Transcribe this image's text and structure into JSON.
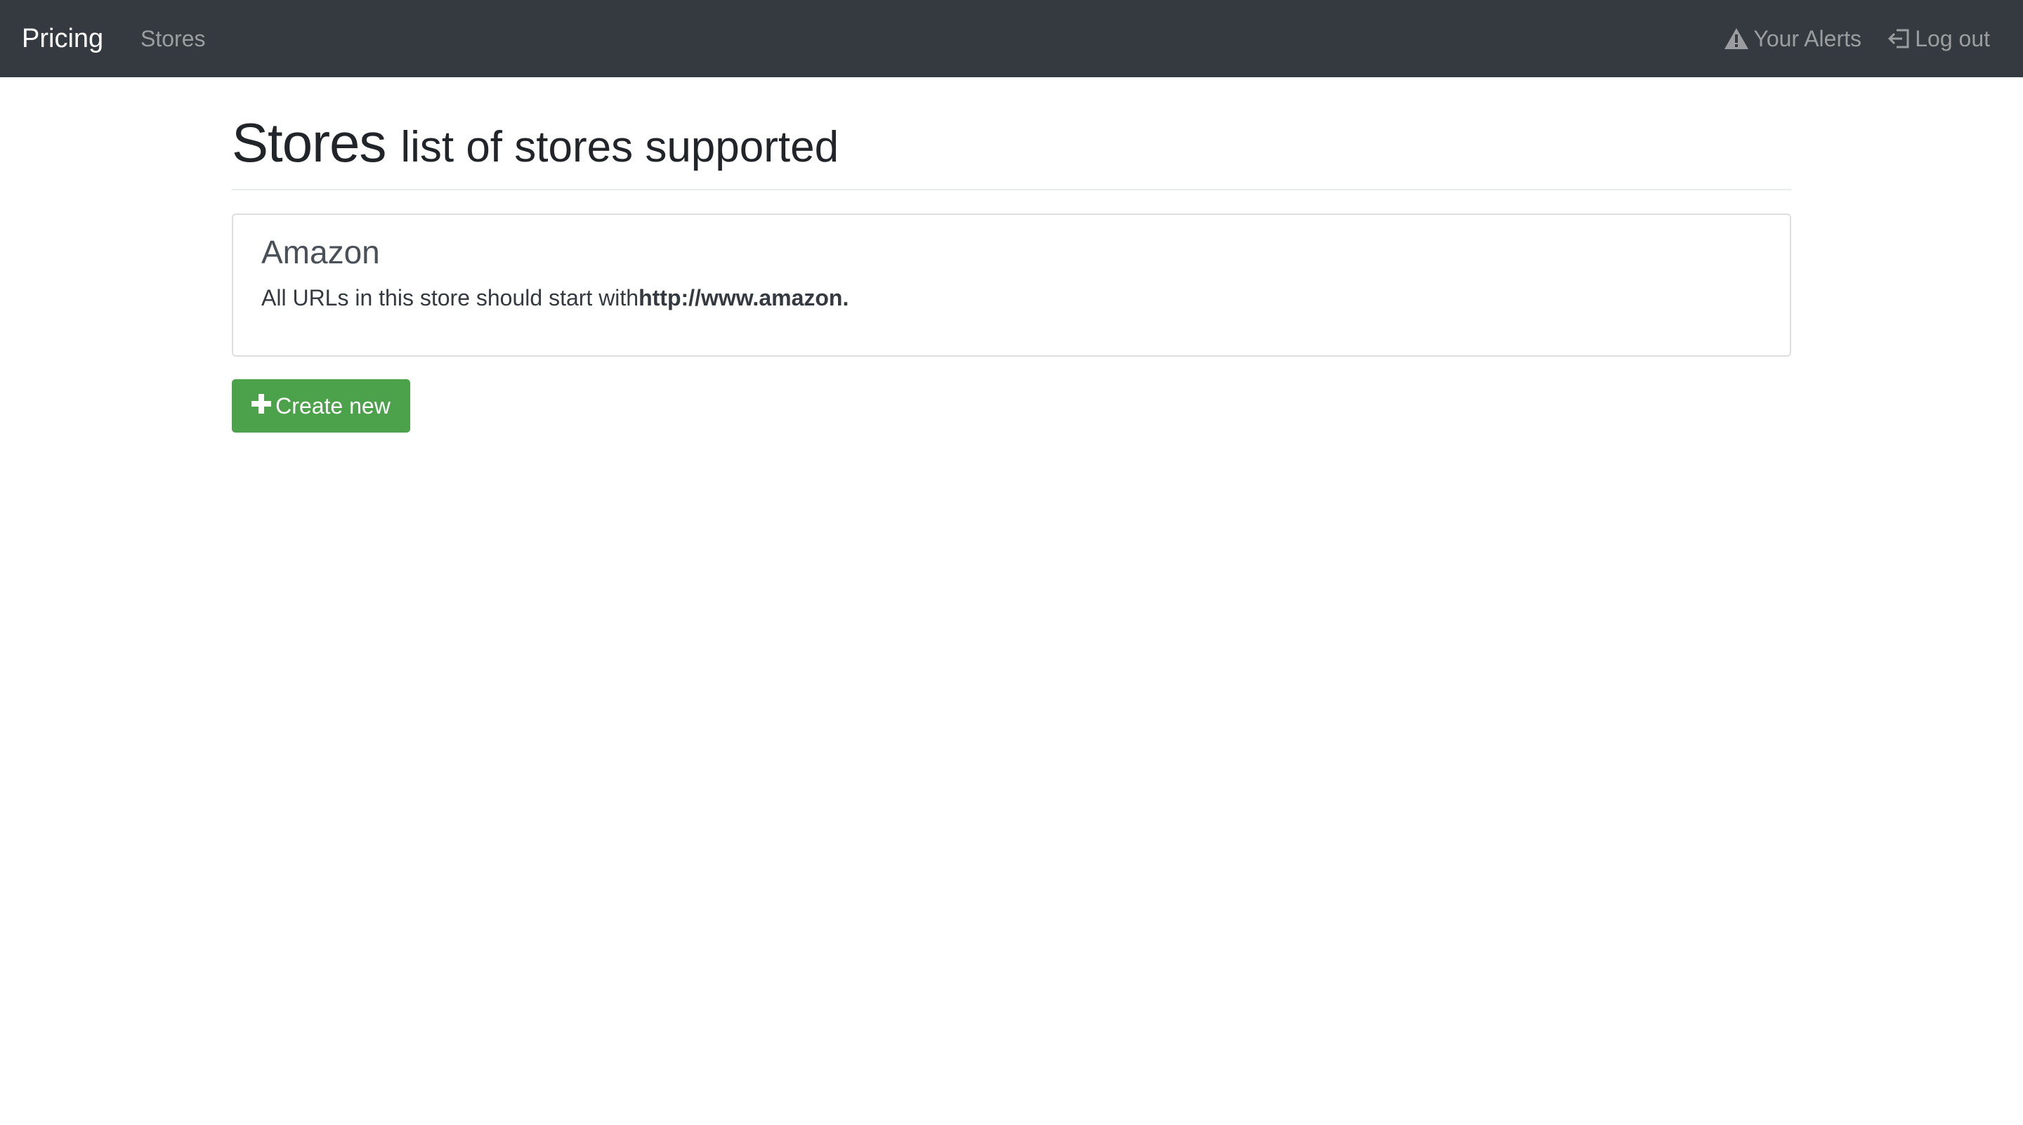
{
  "navbar": {
    "brand": "Pricing",
    "links": {
      "stores": "Stores",
      "alerts": "Your Alerts",
      "logout": "Log out"
    },
    "icons": {
      "alerts": "warning-triangle-icon",
      "logout": "log-out-icon"
    }
  },
  "header": {
    "title": "Stores",
    "subtitle": "list of stores supported"
  },
  "stores": [
    {
      "name": "Amazon",
      "description_prefix": "All URLs in this store should start with",
      "url_prefix": "http://www.amazon."
    }
  ],
  "actions": {
    "create_label": "Create new",
    "create_icon": "plus-icon"
  },
  "colors": {
    "navbar_bg": "#343a40",
    "primary_green": "#4ca24a",
    "nav_link": "#9a9da0"
  }
}
